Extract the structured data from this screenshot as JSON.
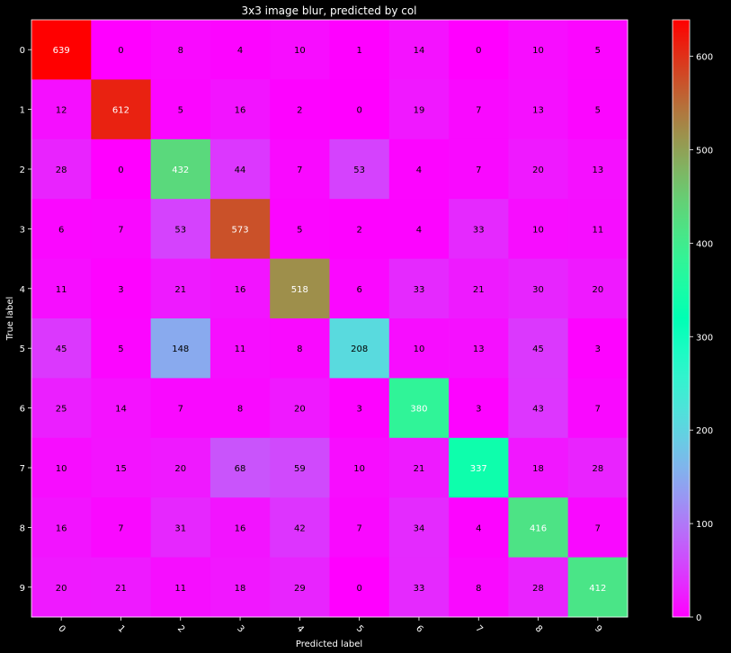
{
  "chart_data": {
    "type": "heatmap",
    "title": "3x3 image blur, predicted by col",
    "xlabel": "Predicted label",
    "ylabel": "True label",
    "x_categories": [
      "0",
      "1",
      "2",
      "3",
      "4",
      "5",
      "6",
      "7",
      "8",
      "9"
    ],
    "y_categories": [
      "0",
      "1",
      "2",
      "3",
      "4",
      "5",
      "6",
      "7",
      "8",
      "9"
    ],
    "matrix": [
      [
        639,
        0,
        8,
        4,
        10,
        1,
        14,
        0,
        10,
        5
      ],
      [
        12,
        612,
        5,
        16,
        2,
        0,
        19,
        7,
        13,
        5
      ],
      [
        28,
        0,
        432,
        44,
        7,
        53,
        4,
        7,
        20,
        13
      ],
      [
        6,
        7,
        53,
        573,
        5,
        2,
        4,
        33,
        10,
        11
      ],
      [
        11,
        3,
        21,
        16,
        518,
        6,
        33,
        21,
        30,
        20
      ],
      [
        45,
        5,
        148,
        11,
        8,
        208,
        10,
        13,
        45,
        3
      ],
      [
        25,
        14,
        7,
        8,
        20,
        3,
        380,
        3,
        43,
        7
      ],
      [
        10,
        15,
        20,
        68,
        59,
        10,
        21,
        337,
        18,
        28
      ],
      [
        16,
        7,
        31,
        16,
        42,
        7,
        34,
        4,
        416,
        7
      ],
      [
        20,
        21,
        11,
        18,
        29,
        0,
        33,
        8,
        28,
        412
      ]
    ],
    "colormap": "rainbow",
    "value_range": [
      0,
      639
    ],
    "colorbar": {
      "ticks": [
        0,
        100,
        200,
        300,
        400,
        500,
        600
      ],
      "tick_labels": [
        "0",
        "100",
        "200",
        "300",
        "400",
        "500",
        "600"
      ],
      "placement": "right"
    },
    "text_color_threshold": 319.5,
    "text_colors": {
      "low": "#000000",
      "high": "#ffffff"
    },
    "x_tick_rotation": "45"
  }
}
